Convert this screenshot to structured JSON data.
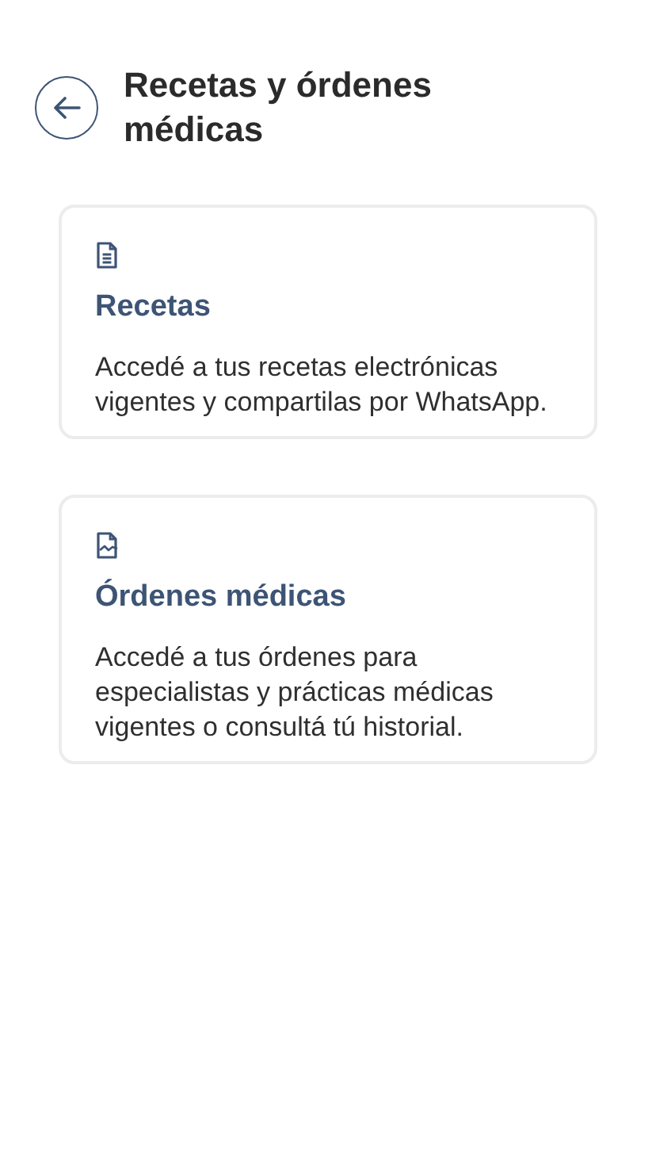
{
  "header": {
    "title": "Recetas y órdenes médicas"
  },
  "cards": [
    {
      "kind": "document",
      "title": "Recetas",
      "description": "Accedé a tus recetas electrónicas vigentes y compartilas por WhatsApp."
    },
    {
      "kind": "chart-document",
      "title": "Órdenes médicas",
      "description": "Accedé a tus órdenes para especialistas y prácticas médicas vigentes o consultá tú historial."
    }
  ]
}
